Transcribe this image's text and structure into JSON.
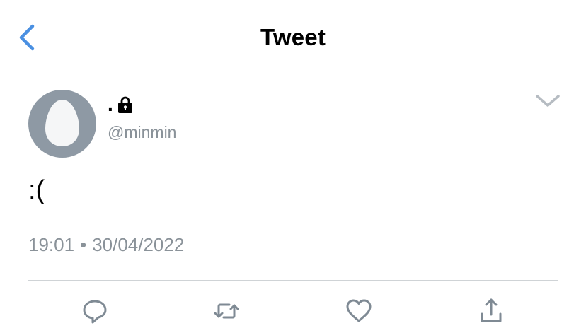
{
  "header": {
    "title": "Tweet",
    "back_icon": "chevron-left-icon"
  },
  "tweet": {
    "author": {
      "display_name": ".",
      "handle": "@minmin",
      "protected_icon": "lock-icon",
      "avatar": "default-egg-avatar"
    },
    "text": ":(",
    "time": "19:01",
    "separator": "•",
    "date": "30/04/2022",
    "menu_icon": "chevron-down-icon"
  },
  "actions": [
    {
      "icon": "reply-icon"
    },
    {
      "icon": "retweet-icon"
    },
    {
      "icon": "like-icon"
    },
    {
      "icon": "share-icon"
    }
  ],
  "colors": {
    "accent": "#4a90e2",
    "icon_gray": "#7f8a94",
    "secondary_text": "#8a9299",
    "avatar_bg": "#8e99a4",
    "avatar_egg": "#f5f6f7",
    "divider": "#cfd3d6"
  }
}
